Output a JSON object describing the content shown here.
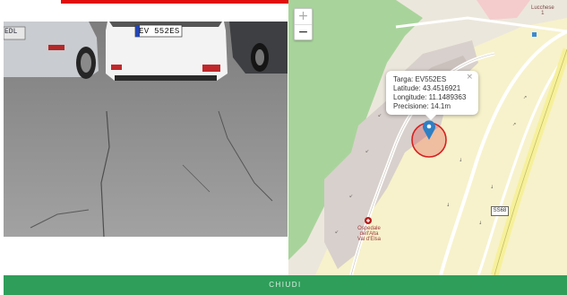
{
  "photo": {
    "plate_left_partial": "EDL",
    "plate_center": "EV 552ES"
  },
  "map": {
    "zoom_in": "+",
    "zoom_out": "−",
    "popup": {
      "plate": "Targa: EV552ES",
      "latitude": "Latitude: 43.4516921",
      "longitude": "Longitude: 11.1489363",
      "precision": "Precisione: 14.1m",
      "close": "×"
    },
    "hospital_line1": "Ospedale",
    "hospital_line2": "dell'Alta",
    "hospital_line3": "Val d'Elsa",
    "top_label_line1": "Lucchese",
    "top_label_line2": "1",
    "road_shield": "SS68"
  },
  "footer": {
    "close_label": "CHIUDI"
  },
  "colors": {
    "top_bar": "#e10e0e",
    "footer": "#2f9e5a",
    "accuracy_circle": "#d62020",
    "marker": "#2f7fc4"
  }
}
